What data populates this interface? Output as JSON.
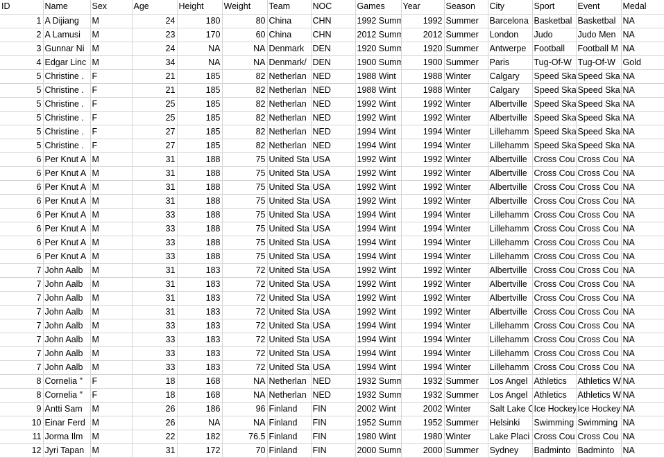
{
  "app": {
    "kind": "spreadsheet",
    "grid_line_color": "#d4d4d4",
    "background_color": "#ffffff",
    "text_color": "#000000"
  },
  "table": {
    "columns": [
      {
        "key": "id",
        "label": "ID",
        "align": "right"
      },
      {
        "key": "name",
        "label": "Name",
        "align": "left"
      },
      {
        "key": "sex",
        "label": "Sex",
        "align": "left"
      },
      {
        "key": "age",
        "label": "Age",
        "align": "right"
      },
      {
        "key": "height",
        "label": "Height",
        "align": "right"
      },
      {
        "key": "weight",
        "label": "Weight",
        "align": "right"
      },
      {
        "key": "team",
        "label": "Team",
        "align": "left"
      },
      {
        "key": "noc",
        "label": "NOC",
        "align": "left"
      },
      {
        "key": "games",
        "label": "Games",
        "align": "left"
      },
      {
        "key": "year",
        "label": "Year",
        "align": "right"
      },
      {
        "key": "season",
        "label": "Season",
        "align": "left"
      },
      {
        "key": "city",
        "label": "City",
        "align": "left"
      },
      {
        "key": "sport",
        "label": "Sport",
        "align": "left"
      },
      {
        "key": "event",
        "label": "Event",
        "align": "left"
      },
      {
        "key": "medal",
        "label": "Medal",
        "align": "left"
      }
    ],
    "rows": [
      {
        "id": "1",
        "name": "A Dijiang",
        "sex": "M",
        "age": "24",
        "height": "180",
        "weight": "80",
        "team": "China",
        "noc": "CHN",
        "games": "1992 Summ",
        "year": "1992",
        "season": "Summer",
        "city": "Barcelona",
        "sport": "Basketbal",
        "event": "Basketbal",
        "medal": "NA"
      },
      {
        "id": "2",
        "name": "A Lamusi",
        "sex": "M",
        "age": "23",
        "height": "170",
        "weight": "60",
        "team": "China",
        "noc": "CHN",
        "games": "2012 Summ",
        "year": "2012",
        "season": "Summer",
        "city": "London",
        "sport": "Judo",
        "event": "Judo Men",
        "medal": "NA"
      },
      {
        "id": "3",
        "name": "Gunnar Ni",
        "sex": "M",
        "age": "24",
        "height": "NA",
        "weight": "NA",
        "team": "Denmark",
        "noc": "DEN",
        "games": "1920 Summ",
        "year": "1920",
        "season": "Summer",
        "city": "Antwerpe",
        "sport": "Football",
        "event": "Football M",
        "medal": "NA"
      },
      {
        "id": "4",
        "name": "Edgar Linc",
        "sex": "M",
        "age": "34",
        "height": "NA",
        "weight": "NA",
        "team": "Denmark/",
        "noc": "DEN",
        "games": "1900 Summ",
        "year": "1900",
        "season": "Summer",
        "city": "Paris",
        "sport": "Tug-Of-W",
        "event": "Tug-Of-W",
        "medal": "Gold"
      },
      {
        "id": "5",
        "name": "Christine .",
        "sex": "F",
        "age": "21",
        "height": "185",
        "weight": "82",
        "team": "Netherlan",
        "noc": "NED",
        "games": "1988 Wint",
        "year": "1988",
        "season": "Winter",
        "city": "Calgary",
        "sport": "Speed Ska",
        "event": "Speed Ska",
        "medal": "NA"
      },
      {
        "id": "5",
        "name": "Christine .",
        "sex": "F",
        "age": "21",
        "height": "185",
        "weight": "82",
        "team": "Netherlan",
        "noc": "NED",
        "games": "1988 Wint",
        "year": "1988",
        "season": "Winter",
        "city": "Calgary",
        "sport": "Speed Ska",
        "event": "Speed Ska",
        "medal": "NA"
      },
      {
        "id": "5",
        "name": "Christine .",
        "sex": "F",
        "age": "25",
        "height": "185",
        "weight": "82",
        "team": "Netherlan",
        "noc": "NED",
        "games": "1992 Wint",
        "year": "1992",
        "season": "Winter",
        "city": "Albertville",
        "sport": "Speed Ska",
        "event": "Speed Ska",
        "medal": "NA"
      },
      {
        "id": "5",
        "name": "Christine .",
        "sex": "F",
        "age": "25",
        "height": "185",
        "weight": "82",
        "team": "Netherlan",
        "noc": "NED",
        "games": "1992 Wint",
        "year": "1992",
        "season": "Winter",
        "city": "Albertville",
        "sport": "Speed Ska",
        "event": "Speed Ska",
        "medal": "NA"
      },
      {
        "id": "5",
        "name": "Christine .",
        "sex": "F",
        "age": "27",
        "height": "185",
        "weight": "82",
        "team": "Netherlan",
        "noc": "NED",
        "games": "1994 Wint",
        "year": "1994",
        "season": "Winter",
        "city": "Lillehamm",
        "sport": "Speed Ska",
        "event": "Speed Ska",
        "medal": "NA"
      },
      {
        "id": "5",
        "name": "Christine .",
        "sex": "F",
        "age": "27",
        "height": "185",
        "weight": "82",
        "team": "Netherlan",
        "noc": "NED",
        "games": "1994 Wint",
        "year": "1994",
        "season": "Winter",
        "city": "Lillehamm",
        "sport": "Speed Ska",
        "event": "Speed Ska",
        "medal": "NA"
      },
      {
        "id": "6",
        "name": "Per Knut A",
        "sex": "M",
        "age": "31",
        "height": "188",
        "weight": "75",
        "team": "United Sta",
        "noc": "USA",
        "games": "1992 Wint",
        "year": "1992",
        "season": "Winter",
        "city": "Albertville",
        "sport": "Cross Cou",
        "event": "Cross Cou",
        "medal": "NA"
      },
      {
        "id": "6",
        "name": "Per Knut A",
        "sex": "M",
        "age": "31",
        "height": "188",
        "weight": "75",
        "team": "United Sta",
        "noc": "USA",
        "games": "1992 Wint",
        "year": "1992",
        "season": "Winter",
        "city": "Albertville",
        "sport": "Cross Cou",
        "event": "Cross Cou",
        "medal": "NA"
      },
      {
        "id": "6",
        "name": "Per Knut A",
        "sex": "M",
        "age": "31",
        "height": "188",
        "weight": "75",
        "team": "United Sta",
        "noc": "USA",
        "games": "1992 Wint",
        "year": "1992",
        "season": "Winter",
        "city": "Albertville",
        "sport": "Cross Cou",
        "event": "Cross Cou",
        "medal": "NA"
      },
      {
        "id": "6",
        "name": "Per Knut A",
        "sex": "M",
        "age": "31",
        "height": "188",
        "weight": "75",
        "team": "United Sta",
        "noc": "USA",
        "games": "1992 Wint",
        "year": "1992",
        "season": "Winter",
        "city": "Albertville",
        "sport": "Cross Cou",
        "event": "Cross Cou",
        "medal": "NA"
      },
      {
        "id": "6",
        "name": "Per Knut A",
        "sex": "M",
        "age": "33",
        "height": "188",
        "weight": "75",
        "team": "United Sta",
        "noc": "USA",
        "games": "1994 Wint",
        "year": "1994",
        "season": "Winter",
        "city": "Lillehamm",
        "sport": "Cross Cou",
        "event": "Cross Cou",
        "medal": "NA"
      },
      {
        "id": "6",
        "name": "Per Knut A",
        "sex": "M",
        "age": "33",
        "height": "188",
        "weight": "75",
        "team": "United Sta",
        "noc": "USA",
        "games": "1994 Wint",
        "year": "1994",
        "season": "Winter",
        "city": "Lillehamm",
        "sport": "Cross Cou",
        "event": "Cross Cou",
        "medal": "NA"
      },
      {
        "id": "6",
        "name": "Per Knut A",
        "sex": "M",
        "age": "33",
        "height": "188",
        "weight": "75",
        "team": "United Sta",
        "noc": "USA",
        "games": "1994 Wint",
        "year": "1994",
        "season": "Winter",
        "city": "Lillehamm",
        "sport": "Cross Cou",
        "event": "Cross Cou",
        "medal": "NA"
      },
      {
        "id": "6",
        "name": "Per Knut A",
        "sex": "M",
        "age": "33",
        "height": "188",
        "weight": "75",
        "team": "United Sta",
        "noc": "USA",
        "games": "1994 Wint",
        "year": "1994",
        "season": "Winter",
        "city": "Lillehamm",
        "sport": "Cross Cou",
        "event": "Cross Cou",
        "medal": "NA"
      },
      {
        "id": "7",
        "name": "John Aalb",
        "sex": "M",
        "age": "31",
        "height": "183",
        "weight": "72",
        "team": "United Sta",
        "noc": "USA",
        "games": "1992 Wint",
        "year": "1992",
        "season": "Winter",
        "city": "Albertville",
        "sport": "Cross Cou",
        "event": "Cross Cou",
        "medal": "NA"
      },
      {
        "id": "7",
        "name": "John Aalb",
        "sex": "M",
        "age": "31",
        "height": "183",
        "weight": "72",
        "team": "United Sta",
        "noc": "USA",
        "games": "1992 Wint",
        "year": "1992",
        "season": "Winter",
        "city": "Albertville",
        "sport": "Cross Cou",
        "event": "Cross Cou",
        "medal": "NA"
      },
      {
        "id": "7",
        "name": "John Aalb",
        "sex": "M",
        "age": "31",
        "height": "183",
        "weight": "72",
        "team": "United Sta",
        "noc": "USA",
        "games": "1992 Wint",
        "year": "1992",
        "season": "Winter",
        "city": "Albertville",
        "sport": "Cross Cou",
        "event": "Cross Cou",
        "medal": "NA"
      },
      {
        "id": "7",
        "name": "John Aalb",
        "sex": "M",
        "age": "31",
        "height": "183",
        "weight": "72",
        "team": "United Sta",
        "noc": "USA",
        "games": "1992 Wint",
        "year": "1992",
        "season": "Winter",
        "city": "Albertville",
        "sport": "Cross Cou",
        "event": "Cross Cou",
        "medal": "NA"
      },
      {
        "id": "7",
        "name": "John Aalb",
        "sex": "M",
        "age": "33",
        "height": "183",
        "weight": "72",
        "team": "United Sta",
        "noc": "USA",
        "games": "1994 Wint",
        "year": "1994",
        "season": "Winter",
        "city": "Lillehamm",
        "sport": "Cross Cou",
        "event": "Cross Cou",
        "medal": "NA"
      },
      {
        "id": "7",
        "name": "John Aalb",
        "sex": "M",
        "age": "33",
        "height": "183",
        "weight": "72",
        "team": "United Sta",
        "noc": "USA",
        "games": "1994 Wint",
        "year": "1994",
        "season": "Winter",
        "city": "Lillehamm",
        "sport": "Cross Cou",
        "event": "Cross Cou",
        "medal": "NA"
      },
      {
        "id": "7",
        "name": "John Aalb",
        "sex": "M",
        "age": "33",
        "height": "183",
        "weight": "72",
        "team": "United Sta",
        "noc": "USA",
        "games": "1994 Wint",
        "year": "1994",
        "season": "Winter",
        "city": "Lillehamm",
        "sport": "Cross Cou",
        "event": "Cross Cou",
        "medal": "NA"
      },
      {
        "id": "7",
        "name": "John Aalb",
        "sex": "M",
        "age": "33",
        "height": "183",
        "weight": "72",
        "team": "United Sta",
        "noc": "USA",
        "games": "1994 Wint",
        "year": "1994",
        "season": "Winter",
        "city": "Lillehamm",
        "sport": "Cross Cou",
        "event": "Cross Cou",
        "medal": "NA"
      },
      {
        "id": "8",
        "name": "Cornelia \"",
        "sex": "F",
        "age": "18",
        "height": "168",
        "weight": "NA",
        "team": "Netherlan",
        "noc": "NED",
        "games": "1932 Summ",
        "year": "1932",
        "season": "Summer",
        "city": "Los Angel",
        "sport": "Athletics",
        "event": "Athletics W",
        "medal": "NA"
      },
      {
        "id": "8",
        "name": "Cornelia \"",
        "sex": "F",
        "age": "18",
        "height": "168",
        "weight": "NA",
        "team": "Netherlan",
        "noc": "NED",
        "games": "1932 Summ",
        "year": "1932",
        "season": "Summer",
        "city": "Los Angel",
        "sport": "Athletics",
        "event": "Athletics W",
        "medal": "NA"
      },
      {
        "id": "9",
        "name": "Antti Sam",
        "sex": "M",
        "age": "26",
        "height": "186",
        "weight": "96",
        "team": "Finland",
        "noc": "FIN",
        "games": "2002 Wint",
        "year": "2002",
        "season": "Winter",
        "city": "Salt Lake C",
        "sport": "Ice Hockey",
        "event": "Ice Hockey",
        "medal": "NA"
      },
      {
        "id": "10",
        "name": "Einar Ferd",
        "sex": "M",
        "age": "26",
        "height": "NA",
        "weight": "NA",
        "team": "Finland",
        "noc": "FIN",
        "games": "1952 Summ",
        "year": "1952",
        "season": "Summer",
        "city": "Helsinki",
        "sport": "Swimming",
        "event": "Swimming",
        "medal": "NA"
      },
      {
        "id": "11",
        "name": "Jorma Ilm",
        "sex": "M",
        "age": "22",
        "height": "182",
        "weight": "76.5",
        "team": "Finland",
        "noc": "FIN",
        "games": "1980 Wint",
        "year": "1980",
        "season": "Winter",
        "city": "Lake Placi",
        "sport": "Cross Cou",
        "event": "Cross Cou",
        "medal": "NA"
      },
      {
        "id": "12",
        "name": "Jyri Tapan",
        "sex": "M",
        "age": "31",
        "height": "172",
        "weight": "70",
        "team": "Finland",
        "noc": "FIN",
        "games": "2000 Summ",
        "year": "2000",
        "season": "Summer",
        "city": "Sydney",
        "sport": "Badminto",
        "event": "Badminto",
        "medal": "NA"
      }
    ]
  }
}
